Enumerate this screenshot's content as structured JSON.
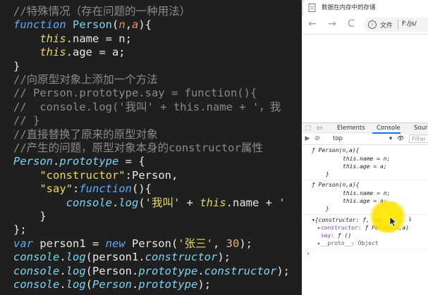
{
  "editor": {
    "lines": [
      [
        {
          "t": "//特殊情况（存在问题的一种用法）",
          "c": "cmt"
        }
      ],
      [
        {
          "t": "function ",
          "c": "kw"
        },
        {
          "t": "Person",
          "c": "fn"
        },
        {
          "t": "(",
          "c": ""
        },
        {
          "t": "n",
          "c": "prm"
        },
        {
          "t": ",",
          "c": ""
        },
        {
          "t": "a",
          "c": "prm"
        },
        {
          "t": "){",
          "c": ""
        }
      ],
      [
        {
          "t": "    ",
          "c": ""
        },
        {
          "t": "this",
          "c": "this"
        },
        {
          "t": ".name = n;",
          "c": ""
        }
      ],
      [
        {
          "t": "    ",
          "c": ""
        },
        {
          "t": "this",
          "c": "this"
        },
        {
          "t": ".age = a;",
          "c": ""
        }
      ],
      [
        {
          "t": "}",
          "c": ""
        }
      ],
      [
        {
          "t": "//向原型对象上添加一个方法",
          "c": "cmt"
        }
      ],
      [
        {
          "t": "// Person.prototype.say = function(){",
          "c": "cmt"
        }
      ],
      [
        {
          "t": "//  console.log('我叫' + this.name + '，我",
          "c": "cmt"
        }
      ],
      [
        {
          "t": "// }",
          "c": "cmt"
        }
      ],
      [
        {
          "t": "//直接替换了原来的原型对象",
          "c": "cmt"
        }
      ],
      [
        {
          "t": "//产生的问题，原型对象本身的constructor属性",
          "c": "cmt"
        }
      ],
      [
        {
          "t": "Person",
          "c": "cls"
        },
        {
          "t": ".",
          "c": ""
        },
        {
          "t": "prototype",
          "c": "cls"
        },
        {
          "t": " = {",
          "c": ""
        }
      ],
      [
        {
          "t": "    ",
          "c": ""
        },
        {
          "t": "\"constructor\"",
          "c": "str"
        },
        {
          "t": ":Person,",
          "c": ""
        }
      ],
      [
        {
          "t": "    ",
          "c": ""
        },
        {
          "t": "\"say\"",
          "c": "str"
        },
        {
          "t": ":",
          "c": ""
        },
        {
          "t": "function",
          "c": "kw"
        },
        {
          "t": "(){",
          "c": ""
        }
      ],
      [
        {
          "t": "        ",
          "c": ""
        },
        {
          "t": "console",
          "c": "cls"
        },
        {
          "t": ".",
          "c": ""
        },
        {
          "t": "log",
          "c": "cls"
        },
        {
          "t": "(",
          "c": ""
        },
        {
          "t": "'我叫'",
          "c": "str"
        },
        {
          "t": " + ",
          "c": ""
        },
        {
          "t": "this",
          "c": "this"
        },
        {
          "t": ".name + ",
          "c": ""
        },
        {
          "t": "'",
          "c": "str"
        }
      ],
      [
        {
          "t": "    }",
          "c": ""
        }
      ],
      [
        {
          "t": "};",
          "c": ""
        }
      ],
      [
        {
          "t": "var ",
          "c": "kw"
        },
        {
          "t": "person1 = ",
          "c": ""
        },
        {
          "t": "new ",
          "c": "kw"
        },
        {
          "t": "Person(",
          "c": ""
        },
        {
          "t": "'张三'",
          "c": "str"
        },
        {
          "t": ", ",
          "c": ""
        },
        {
          "t": "30",
          "c": "num"
        },
        {
          "t": ");",
          "c": ""
        }
      ],
      [
        {
          "t": "console",
          "c": "cls"
        },
        {
          "t": ".",
          "c": ""
        },
        {
          "t": "log",
          "c": "cls"
        },
        {
          "t": "(person1.",
          "c": ""
        },
        {
          "t": "constructor",
          "c": "cls"
        },
        {
          "t": ");",
          "c": ""
        }
      ],
      [
        {
          "t": "console",
          "c": "cls"
        },
        {
          "t": ".",
          "c": ""
        },
        {
          "t": "log",
          "c": "cls"
        },
        {
          "t": "(Person.",
          "c": ""
        },
        {
          "t": "prototype",
          "c": "cls"
        },
        {
          "t": ".",
          "c": ""
        },
        {
          "t": "constructor",
          "c": "cls"
        },
        {
          "t": ");",
          "c": ""
        }
      ],
      [
        {
          "t": "console",
          "c": "cls"
        },
        {
          "t": ".",
          "c": ""
        },
        {
          "t": "log",
          "c": "cls"
        },
        {
          "t": "(",
          "c": ""
        },
        {
          "t": "Person",
          "c": "cls"
        },
        {
          "t": ".",
          "c": ""
        },
        {
          "t": "prototype",
          "c": "cls"
        },
        {
          "t": ");",
          "c": ""
        }
      ]
    ]
  },
  "browser": {
    "tab_title": "数据在内存中的存储",
    "back": "←",
    "forward": "→",
    "reload": "C",
    "info": "i",
    "file_label": "文件",
    "url": "F:/js/"
  },
  "devtools": {
    "tabs": [
      "Elements",
      "Console",
      "Sour"
    ],
    "active_tab": "Console",
    "context": "top",
    "filter_placeholder": "Filter",
    "icon_inspect": "⬚",
    "icon_device": "▭",
    "icon_clear": "⊘",
    "icon_play": "▶",
    "icon_ctx_arrow": "▾",
    "icon_eye": "👁",
    "output": {
      "fn1_sig": "ƒ Person(n,a){",
      "fn1_l1": "this.name = n;",
      "fn1_l2": "this.age = a;",
      "fn1_end": "}",
      "fn2_sig": "ƒ Person(n,a){",
      "fn2_l1": "this.name = n;",
      "fn2_l2": "this.age = a;",
      "fn2_end": "}",
      "obj_summary": "▾{constructor: ƒ, say: ƒ}",
      "obj_info": "ℹ",
      "obj_p1_key": "▸constructor: ",
      "obj_p1_val": "ƒ Person(n,a)",
      "obj_p2_key": " say: ",
      "obj_p2_val": "ƒ ()",
      "obj_p3": "▸__proto__: Object",
      "prompt": "›"
    }
  }
}
